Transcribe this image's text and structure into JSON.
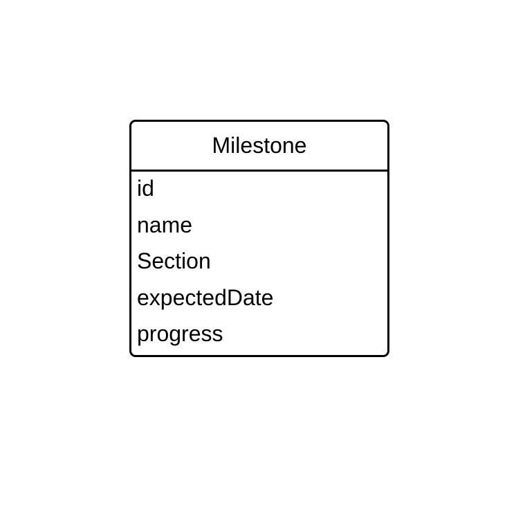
{
  "entity": {
    "title": "Milestone",
    "attributes": [
      "id",
      "name",
      "Section",
      "expectedDate",
      "progress"
    ]
  }
}
